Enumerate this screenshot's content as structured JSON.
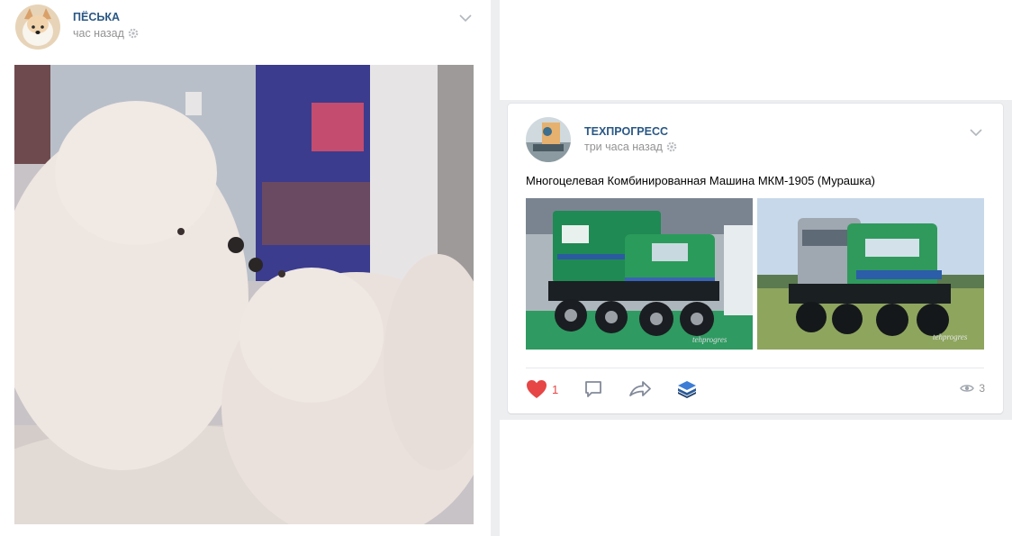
{
  "post1": {
    "author": "ПЁСЬКА",
    "time": "час назад",
    "photo": "two-samoyed-dogs-photo",
    "avatar": "dog-avatar"
  },
  "post2": {
    "author": "ТЕХПРОГРЕСС",
    "time": "три часа назад",
    "text": "Многоцелевая Комбинированная Машина МКМ-1905 (Мурашка)",
    "photos": [
      "green-atv-truck-indoor-photo",
      "green-atv-truck-field-photo"
    ],
    "watermark": "tehprogres",
    "likes": "1",
    "views": "3",
    "accent_like": "#e64646",
    "icons": [
      "heart-icon",
      "comment-icon",
      "share-icon",
      "layers-icon",
      "eye-icon"
    ]
  }
}
